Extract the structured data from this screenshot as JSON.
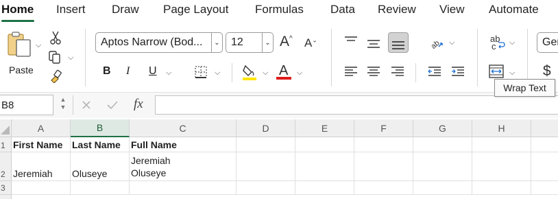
{
  "tabs": [
    "Home",
    "Insert",
    "Draw",
    "Page Layout",
    "Formulas",
    "Data",
    "Review",
    "View",
    "Automate"
  ],
  "clipboard": {
    "paste_label": "Paste"
  },
  "font": {
    "name": "Aptos Narrow (Bod...",
    "size": "12",
    "bold": "B",
    "italic": "I",
    "underline": "U",
    "font_color_letter": "A",
    "grow": "A",
    "shrink": "A"
  },
  "wrap": {
    "abc": "ab",
    "c": "c"
  },
  "number_format": {
    "value": "Ger",
    "currency": "$"
  },
  "tooltip": "Wrap Text",
  "formula_bar": {
    "name_box": "B8",
    "fx": "fx",
    "formula": ""
  },
  "colors": {
    "accent": "#1e7145",
    "highlight": "#ffe600",
    "font_color": "#e01c1c"
  },
  "columns": [
    "A",
    "B",
    "C",
    "D",
    "E",
    "F",
    "G",
    "H"
  ],
  "selected_column": "B",
  "rows": [
    {
      "num": "1",
      "cells": [
        "First Name",
        "Last Name",
        "Full Name",
        "",
        "",
        "",
        "",
        "",
        ""
      ]
    },
    {
      "num": "2",
      "cells": [
        "Jeremiah",
        "Oluseye",
        "",
        "",
        "",
        "",
        "",
        "",
        ""
      ],
      "wrap_line1": "Jeremiah",
      "wrap_line2": "Oluseye"
    },
    {
      "num": "3",
      "cells": [
        "",
        "",
        "",
        "",
        "",
        "",
        "",
        "",
        ""
      ]
    }
  ]
}
